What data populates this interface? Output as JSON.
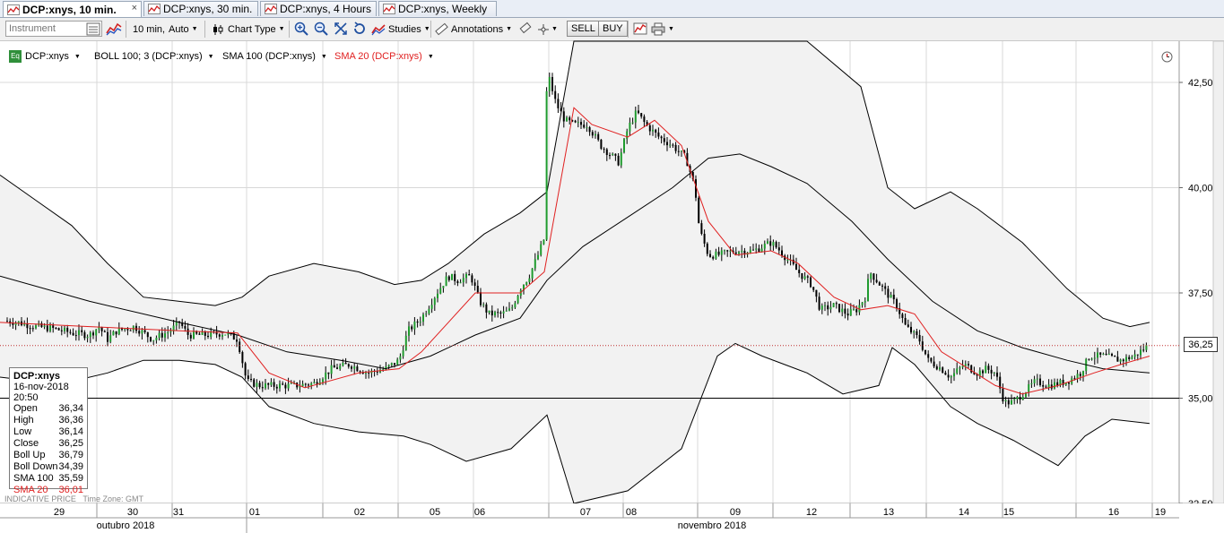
{
  "tabs": [
    {
      "label": "DCP:xnys, 10 min.",
      "active": true,
      "close": "×"
    },
    {
      "label": "DCP:xnys, 30 min.",
      "active": false
    },
    {
      "label": "DCP:xnys, 4 Hours",
      "active": false
    },
    {
      "label": "DCP:xnys, Weekly",
      "active": false
    }
  ],
  "toolbar": {
    "instrument_placeholder": "Instrument",
    "interval_label": "10 min,",
    "interval_mode": "Auto",
    "chart_type_label": "Chart Type",
    "studies_label": "Studies",
    "annotations_label": "Annotations",
    "sell_label": "SELL",
    "buy_label": "BUY"
  },
  "legend": {
    "eq_badge": "Eq",
    "symbol": "DCP:xnys",
    "boll": "BOLL 100; 3 (DCP:xnys)",
    "sma100": "SMA 100 (DCP:xnys)",
    "sma20": "SMA 20 (DCP:xnys)"
  },
  "colors": {
    "sma20": "#e02020",
    "sma100": "#000000",
    "band_fill": "#f2f2f2",
    "candle_up": "#1f9b2e",
    "candle_down": "#000000",
    "price_line": "#c03030"
  },
  "infobox": {
    "title": "DCP:xnys",
    "datetime": "16-nov-2018 20:50",
    "rows": [
      {
        "label": "Open",
        "value": "36,34"
      },
      {
        "label": "High",
        "value": "36,36"
      },
      {
        "label": "Low",
        "value": "36,14"
      },
      {
        "label": "Close",
        "value": "36,25"
      },
      {
        "label": "Boll Up",
        "value": "36,79"
      },
      {
        "label": "Boll Down",
        "value": "34,39"
      },
      {
        "label": "SMA 100",
        "value": "35,59"
      },
      {
        "label": "SMA 20",
        "value": "36,01"
      }
    ]
  },
  "footer": {
    "indicative": "INDICATIVE PRICE",
    "timezone": "Time Zone: GMT"
  },
  "last_price": "36,25",
  "chart_data": {
    "type": "candlestick",
    "ylim": [
      32.5,
      43.0
    ],
    "y_ticks": [
      "42,50",
      "40,00",
      "37,50",
      "35,00",
      "32,50"
    ],
    "y_tick_values": [
      42.5,
      40.0,
      37.5,
      35.0,
      32.5
    ],
    "reference_line": 35.0,
    "last_close": 36.25,
    "day_labels": [
      "29",
      "30",
      "31",
      "01",
      "02",
      "05",
      "06",
      "07",
      "08",
      "09",
      "12",
      "13",
      "14",
      "15",
      "16",
      "19"
    ],
    "month_labels": [
      "outubro 2018",
      "novembro 2018"
    ],
    "close_path": [
      [
        0,
        36.85
      ],
      [
        20,
        36.8
      ],
      [
        40,
        36.7
      ],
      [
        60,
        36.65
      ],
      [
        80,
        36.55
      ],
      [
        100,
        36.5
      ],
      [
        110,
        36.7
      ],
      [
        120,
        36.4
      ],
      [
        130,
        36.6
      ],
      [
        150,
        36.7
      ],
      [
        170,
        36.4
      ],
      [
        190,
        36.6
      ],
      [
        200,
        36.8
      ],
      [
        210,
        36.5
      ],
      [
        230,
        36.5
      ],
      [
        250,
        36.55
      ],
      [
        265,
        36.4
      ],
      [
        275,
        35.4
      ],
      [
        290,
        35.3
      ],
      [
        310,
        35.3
      ],
      [
        330,
        35.3
      ],
      [
        350,
        35.35
      ],
      [
        370,
        35.7
      ],
      [
        390,
        35.8
      ],
      [
        410,
        35.6
      ],
      [
        430,
        35.7
      ],
      [
        445,
        35.9
      ],
      [
        455,
        36.6
      ],
      [
        470,
        36.9
      ],
      [
        490,
        37.6
      ],
      [
        500,
        37.9
      ],
      [
        510,
        37.8
      ],
      [
        525,
        37.9
      ],
      [
        535,
        37.3
      ],
      [
        545,
        37.0
      ],
      [
        560,
        37.0
      ],
      [
        570,
        37.1
      ],
      [
        580,
        37.6
      ],
      [
        590,
        37.9
      ],
      [
        600,
        38.4
      ],
      [
        607,
        38.8
      ],
      [
        610,
        42.8
      ],
      [
        620,
        42.0
      ],
      [
        630,
        41.6
      ],
      [
        640,
        41.5
      ],
      [
        655,
        41.5
      ],
      [
        670,
        41.0
      ],
      [
        690,
        40.6
      ],
      [
        700,
        41.4
      ],
      [
        710,
        41.8
      ],
      [
        720,
        41.5
      ],
      [
        735,
        41.2
      ],
      [
        750,
        41.0
      ],
      [
        765,
        40.7
      ],
      [
        775,
        40.0
      ],
      [
        780,
        39.0
      ],
      [
        790,
        38.4
      ],
      [
        800,
        38.4
      ],
      [
        820,
        38.5
      ],
      [
        840,
        38.5
      ],
      [
        860,
        38.7
      ],
      [
        870,
        38.5
      ],
      [
        890,
        38.0
      ],
      [
        905,
        37.7
      ],
      [
        915,
        37.1
      ],
      [
        930,
        37.2
      ],
      [
        945,
        37.0
      ],
      [
        955,
        37.1
      ],
      [
        965,
        37.4
      ],
      [
        970,
        38.0
      ],
      [
        985,
        37.6
      ],
      [
        1000,
        37.2
      ],
      [
        1010,
        36.7
      ],
      [
        1025,
        36.4
      ],
      [
        1035,
        35.9
      ],
      [
        1050,
        35.7
      ],
      [
        1060,
        35.5
      ],
      [
        1075,
        35.8
      ],
      [
        1090,
        35.6
      ],
      [
        1100,
        35.7
      ],
      [
        1110,
        35.6
      ],
      [
        1120,
        34.9
      ],
      [
        1130,
        34.9
      ],
      [
        1140,
        35.1
      ],
      [
        1155,
        35.4
      ],
      [
        1170,
        35.3
      ],
      [
        1190,
        35.4
      ],
      [
        1205,
        35.6
      ],
      [
        1215,
        36.0
      ],
      [
        1230,
        36.0
      ],
      [
        1250,
        35.9
      ],
      [
        1265,
        36.0
      ],
      [
        1280,
        36.25
      ]
    ],
    "sma20_path": [
      [
        0,
        36.8
      ],
      [
        100,
        36.7
      ],
      [
        200,
        36.6
      ],
      [
        265,
        36.55
      ],
      [
        300,
        35.6
      ],
      [
        340,
        35.25
      ],
      [
        400,
        35.6
      ],
      [
        445,
        35.7
      ],
      [
        470,
        36.1
      ],
      [
        500,
        36.8
      ],
      [
        530,
        37.5
      ],
      [
        580,
        37.5
      ],
      [
        607,
        38.0
      ],
      [
        640,
        41.9
      ],
      [
        660,
        41.5
      ],
      [
        700,
        41.2
      ],
      [
        730,
        41.6
      ],
      [
        760,
        41.0
      ],
      [
        790,
        39.2
      ],
      [
        820,
        38.4
      ],
      [
        860,
        38.5
      ],
      [
        890,
        38.2
      ],
      [
        930,
        37.4
      ],
      [
        960,
        37.1
      ],
      [
        990,
        37.2
      ],
      [
        1020,
        37.0
      ],
      [
        1050,
        36.1
      ],
      [
        1080,
        35.7
      ],
      [
        1110,
        35.3
      ],
      [
        1140,
        35.1
      ],
      [
        1180,
        35.3
      ],
      [
        1220,
        35.6
      ],
      [
        1250,
        35.8
      ],
      [
        1282,
        36.0
      ]
    ],
    "sma100_path": [
      [
        0,
        37.9
      ],
      [
        100,
        37.3
      ],
      [
        200,
        36.8
      ],
      [
        265,
        36.5
      ],
      [
        320,
        36.1
      ],
      [
        380,
        35.9
      ],
      [
        430,
        35.7
      ],
      [
        480,
        36.0
      ],
      [
        530,
        36.5
      ],
      [
        580,
        36.9
      ],
      [
        610,
        37.8
      ],
      [
        650,
        38.6
      ],
      [
        700,
        39.3
      ],
      [
        750,
        40.0
      ],
      [
        790,
        40.7
      ],
      [
        825,
        40.8
      ],
      [
        860,
        40.5
      ],
      [
        900,
        40.1
      ],
      [
        950,
        39.2
      ],
      [
        990,
        38.3
      ],
      [
        1040,
        37.3
      ],
      [
        1090,
        36.6
      ],
      [
        1140,
        36.2
      ],
      [
        1190,
        35.9
      ],
      [
        1230,
        35.7
      ],
      [
        1282,
        35.6
      ]
    ],
    "boll_upper_path": [
      [
        0,
        40.3
      ],
      [
        40,
        39.7
      ],
      [
        80,
        39.1
      ],
      [
        120,
        38.2
      ],
      [
        160,
        37.4
      ],
      [
        200,
        37.3
      ],
      [
        240,
        37.2
      ],
      [
        270,
        37.4
      ],
      [
        300,
        37.9
      ],
      [
        350,
        38.2
      ],
      [
        400,
        38.0
      ],
      [
        440,
        37.7
      ],
      [
        470,
        37.8
      ],
      [
        500,
        38.2
      ],
      [
        540,
        38.9
      ],
      [
        580,
        39.4
      ],
      [
        610,
        39.9
      ],
      [
        640,
        44.5
      ],
      [
        700,
        45.5
      ],
      [
        760,
        45.5
      ],
      [
        820,
        45.5
      ],
      [
        900,
        44.8
      ],
      [
        960,
        42.4
      ],
      [
        990,
        40.0
      ],
      [
        1020,
        39.5
      ],
      [
        1060,
        39.9
      ],
      [
        1090,
        39.5
      ],
      [
        1140,
        38.7
      ],
      [
        1190,
        37.6
      ],
      [
        1230,
        36.9
      ],
      [
        1260,
        36.7
      ],
      [
        1282,
        36.8
      ]
    ],
    "boll_lower_path": [
      [
        0,
        35.5
      ],
      [
        40,
        35.4
      ],
      [
        80,
        35.4
      ],
      [
        120,
        35.6
      ],
      [
        160,
        35.9
      ],
      [
        200,
        35.9
      ],
      [
        240,
        35.8
      ],
      [
        270,
        35.5
      ],
      [
        300,
        34.8
      ],
      [
        350,
        34.4
      ],
      [
        400,
        34.2
      ],
      [
        450,
        34.1
      ],
      [
        480,
        33.9
      ],
      [
        520,
        33.5
      ],
      [
        570,
        33.8
      ],
      [
        610,
        34.6
      ],
      [
        640,
        32.0
      ],
      [
        700,
        32.8
      ],
      [
        760,
        33.8
      ],
      [
        800,
        36.0
      ],
      [
        820,
        36.3
      ],
      [
        850,
        36.0
      ],
      [
        900,
        35.6
      ],
      [
        940,
        35.1
      ],
      [
        980,
        35.3
      ],
      [
        995,
        36.2
      ],
      [
        1020,
        35.8
      ],
      [
        1060,
        34.8
      ],
      [
        1090,
        34.4
      ],
      [
        1130,
        34.0
      ],
      [
        1180,
        33.4
      ],
      [
        1210,
        34.1
      ],
      [
        1240,
        34.5
      ],
      [
        1282,
        34.4
      ]
    ]
  }
}
